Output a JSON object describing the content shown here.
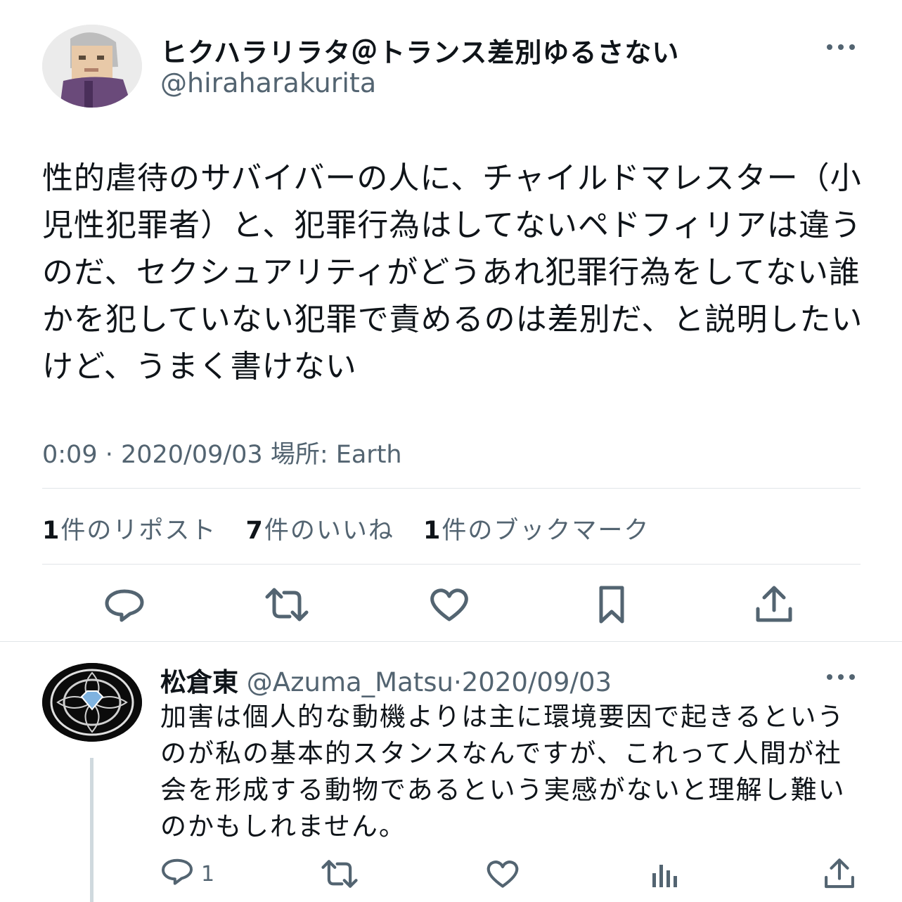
{
  "tweet": {
    "display_name": "ヒクハラリラタ＠トランス差別ゆるさない",
    "handle": "@hiraharakurita",
    "body": "性的虐待のサバイバーの人に、チャイルドマレスター（小児性犯罪者）と、犯罪行為はしてないペドフィリアは違うのだ、セクシュアリティがどうあれ犯罪行為をしてない誰かを犯していない犯罪で責めるのは差別だ、と説明したいけど、うまく書けない",
    "meta": "0:09 · 2020/09/03 場所: Earth",
    "stats": {
      "reposts_count": "1",
      "reposts_label": "件のリポスト",
      "likes_count": "7",
      "likes_label": "件のいいね",
      "bookmarks_count": "1",
      "bookmarks_label": "件のブックマーク"
    },
    "actions": [
      "reply-icon",
      "repost-icon",
      "like-icon",
      "bookmark-icon",
      "share-icon"
    ]
  },
  "reply": {
    "display_name": "松倉東",
    "handle": "@Azuma_Matsu",
    "separator": "·",
    "date": "2020/09/03",
    "body": "加害は個人的な動機よりは主に環境要因で起きるというのが私の基本的スタンスなんですが、これって人間が社会を形成する動物であるという実感がないと理解し難いのかもしれません。",
    "reply_count": "1",
    "actions": [
      "reply-icon",
      "repost-icon",
      "like-icon",
      "analytics-icon",
      "share-icon"
    ]
  },
  "colors": {
    "text_primary": "#0f1419",
    "text_secondary": "#536471",
    "divider": "#e1e5e8"
  }
}
